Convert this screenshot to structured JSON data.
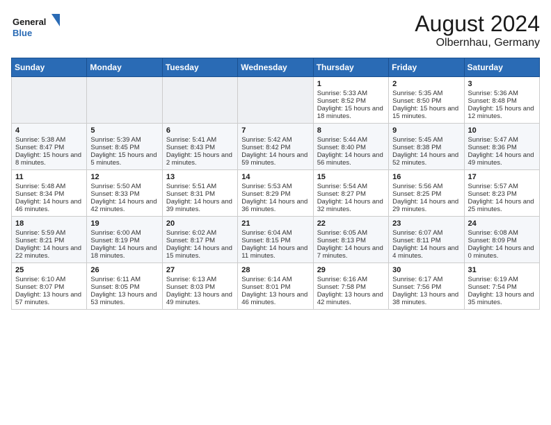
{
  "header": {
    "logo_general": "General",
    "logo_blue": "Blue",
    "month_year": "August 2024",
    "location": "Olbernhau, Germany"
  },
  "days_of_week": [
    "Sunday",
    "Monday",
    "Tuesday",
    "Wednesday",
    "Thursday",
    "Friday",
    "Saturday"
  ],
  "weeks": [
    [
      {
        "day": "",
        "content": ""
      },
      {
        "day": "",
        "content": ""
      },
      {
        "day": "",
        "content": ""
      },
      {
        "day": "",
        "content": ""
      },
      {
        "day": "1",
        "content": "Sunrise: 5:33 AM\nSunset: 8:52 PM\nDaylight: 15 hours and 18 minutes."
      },
      {
        "day": "2",
        "content": "Sunrise: 5:35 AM\nSunset: 8:50 PM\nDaylight: 15 hours and 15 minutes."
      },
      {
        "day": "3",
        "content": "Sunrise: 5:36 AM\nSunset: 8:48 PM\nDaylight: 15 hours and 12 minutes."
      }
    ],
    [
      {
        "day": "4",
        "content": "Sunrise: 5:38 AM\nSunset: 8:47 PM\nDaylight: 15 hours and 8 minutes."
      },
      {
        "day": "5",
        "content": "Sunrise: 5:39 AM\nSunset: 8:45 PM\nDaylight: 15 hours and 5 minutes."
      },
      {
        "day": "6",
        "content": "Sunrise: 5:41 AM\nSunset: 8:43 PM\nDaylight: 15 hours and 2 minutes."
      },
      {
        "day": "7",
        "content": "Sunrise: 5:42 AM\nSunset: 8:42 PM\nDaylight: 14 hours and 59 minutes."
      },
      {
        "day": "8",
        "content": "Sunrise: 5:44 AM\nSunset: 8:40 PM\nDaylight: 14 hours and 56 minutes."
      },
      {
        "day": "9",
        "content": "Sunrise: 5:45 AM\nSunset: 8:38 PM\nDaylight: 14 hours and 52 minutes."
      },
      {
        "day": "10",
        "content": "Sunrise: 5:47 AM\nSunset: 8:36 PM\nDaylight: 14 hours and 49 minutes."
      }
    ],
    [
      {
        "day": "11",
        "content": "Sunrise: 5:48 AM\nSunset: 8:34 PM\nDaylight: 14 hours and 46 minutes."
      },
      {
        "day": "12",
        "content": "Sunrise: 5:50 AM\nSunset: 8:33 PM\nDaylight: 14 hours and 42 minutes."
      },
      {
        "day": "13",
        "content": "Sunrise: 5:51 AM\nSunset: 8:31 PM\nDaylight: 14 hours and 39 minutes."
      },
      {
        "day": "14",
        "content": "Sunrise: 5:53 AM\nSunset: 8:29 PM\nDaylight: 14 hours and 36 minutes."
      },
      {
        "day": "15",
        "content": "Sunrise: 5:54 AM\nSunset: 8:27 PM\nDaylight: 14 hours and 32 minutes."
      },
      {
        "day": "16",
        "content": "Sunrise: 5:56 AM\nSunset: 8:25 PM\nDaylight: 14 hours and 29 minutes."
      },
      {
        "day": "17",
        "content": "Sunrise: 5:57 AM\nSunset: 8:23 PM\nDaylight: 14 hours and 25 minutes."
      }
    ],
    [
      {
        "day": "18",
        "content": "Sunrise: 5:59 AM\nSunset: 8:21 PM\nDaylight: 14 hours and 22 minutes."
      },
      {
        "day": "19",
        "content": "Sunrise: 6:00 AM\nSunset: 8:19 PM\nDaylight: 14 hours and 18 minutes."
      },
      {
        "day": "20",
        "content": "Sunrise: 6:02 AM\nSunset: 8:17 PM\nDaylight: 14 hours and 15 minutes."
      },
      {
        "day": "21",
        "content": "Sunrise: 6:04 AM\nSunset: 8:15 PM\nDaylight: 14 hours and 11 minutes."
      },
      {
        "day": "22",
        "content": "Sunrise: 6:05 AM\nSunset: 8:13 PM\nDaylight: 14 hours and 7 minutes."
      },
      {
        "day": "23",
        "content": "Sunrise: 6:07 AM\nSunset: 8:11 PM\nDaylight: 14 hours and 4 minutes."
      },
      {
        "day": "24",
        "content": "Sunrise: 6:08 AM\nSunset: 8:09 PM\nDaylight: 14 hours and 0 minutes."
      }
    ],
    [
      {
        "day": "25",
        "content": "Sunrise: 6:10 AM\nSunset: 8:07 PM\nDaylight: 13 hours and 57 minutes."
      },
      {
        "day": "26",
        "content": "Sunrise: 6:11 AM\nSunset: 8:05 PM\nDaylight: 13 hours and 53 minutes."
      },
      {
        "day": "27",
        "content": "Sunrise: 6:13 AM\nSunset: 8:03 PM\nDaylight: 13 hours and 49 minutes."
      },
      {
        "day": "28",
        "content": "Sunrise: 6:14 AM\nSunset: 8:01 PM\nDaylight: 13 hours and 46 minutes."
      },
      {
        "day": "29",
        "content": "Sunrise: 6:16 AM\nSunset: 7:58 PM\nDaylight: 13 hours and 42 minutes."
      },
      {
        "day": "30",
        "content": "Sunrise: 6:17 AM\nSunset: 7:56 PM\nDaylight: 13 hours and 38 minutes."
      },
      {
        "day": "31",
        "content": "Sunrise: 6:19 AM\nSunset: 7:54 PM\nDaylight: 13 hours and 35 minutes."
      }
    ]
  ]
}
